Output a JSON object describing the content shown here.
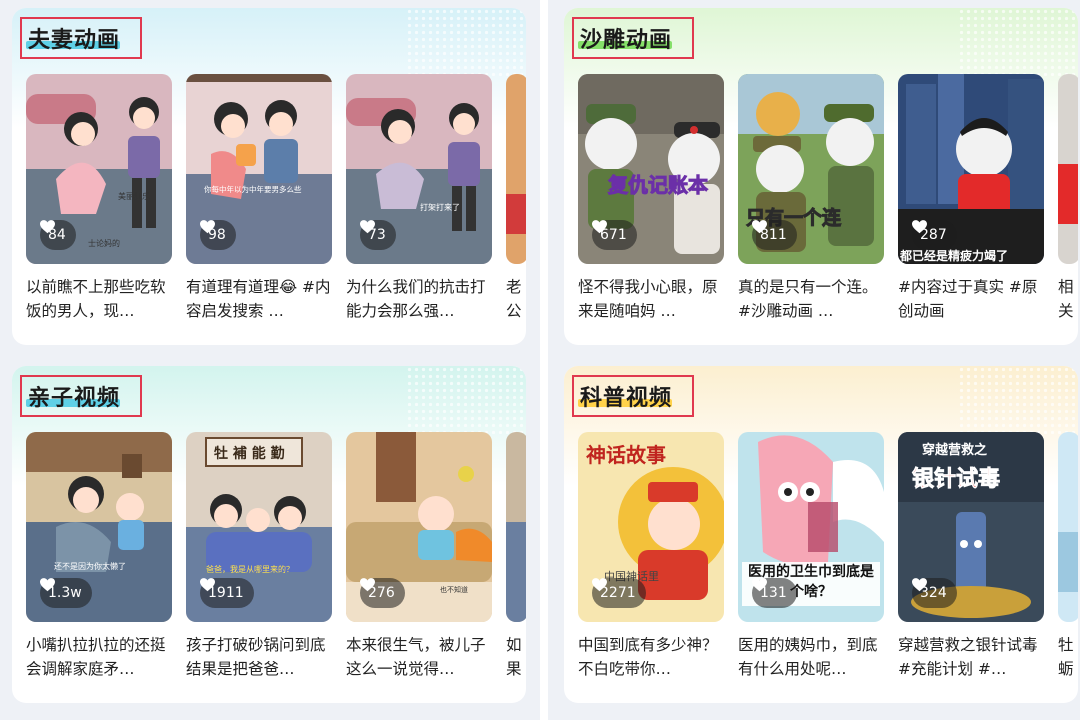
{
  "sections": [
    {
      "title": "夫妻动画",
      "accent": "#5fd0e6",
      "cards": [
        {
          "likes": "84",
          "caption": "以前瞧不上那些吃软饭的男人，现…"
        },
        {
          "likes": "98",
          "caption": "有道理有道理😂 #内容启发搜索 …"
        },
        {
          "likes": "73",
          "caption": "为什么我们的抗击打能力会那么强…"
        },
        {
          "likes": "",
          "caption": "老公一拉"
        }
      ]
    },
    {
      "title": "沙雕动画",
      "accent": "#86e06a",
      "cards": [
        {
          "likes": "671",
          "caption": "怪不得我小心眼，原来是随咱妈 …"
        },
        {
          "likes": "811",
          "caption": "真的是只有一个连。#沙雕动画 …"
        },
        {
          "likes": "287",
          "caption": "#内容过于真实 #原创动画"
        },
        {
          "likes": "",
          "caption": "相关是不"
        }
      ]
    },
    {
      "title": "亲子视频",
      "accent": "#5fd0e6",
      "cards": [
        {
          "likes": "1.3w",
          "caption": "小嘴扒拉扒拉的还挺会调解家庭矛…"
        },
        {
          "likes": "1911",
          "caption": "孩子打破砂锅问到底结果是把爸爸…"
        },
        {
          "likes": "276",
          "caption": "本来很生气，被儿子这么一说觉得…"
        },
        {
          "likes": "",
          "caption": "如果老婆"
        }
      ]
    },
    {
      "title": "科普视频",
      "accent": "#ffd24a",
      "cards": [
        {
          "likes": "2271",
          "caption": "中国到底有多少神？不白吃带你…"
        },
        {
          "likes": "131",
          "caption": "医用的姨妈巾，到底有什么用处呢…"
        },
        {
          "likes": "324",
          "caption": "穿越营救之银针试毒 #充能计划 #…"
        },
        {
          "likes": "",
          "caption": "牡蛎也有"
        }
      ]
    }
  ],
  "thumb_text": {
    "s1c1": "美丽红乐",
    "s1c1b": "士论妈的",
    "s1c2": "你每中年以为中年要男多么些",
    "s1c3": "打架打来了",
    "s2c1": "复仇记账本",
    "s2c2": "只有一个连",
    "s2c3": "都已经是精疲力竭了",
    "s3c1": "还不是因为你太懒了",
    "s3c2a": "牡 補 能 勤",
    "s3c2b": "爸爸，我是从哪里来的？",
    "s3c3": "也不知道",
    "s4c1": "神话故事",
    "s4c1b": "中国神话里",
    "s4c2": "医用的卫生巾到底是个啥？",
    "s4c3a": "穿越营救之",
    "s4c3b": "银针试毒"
  }
}
